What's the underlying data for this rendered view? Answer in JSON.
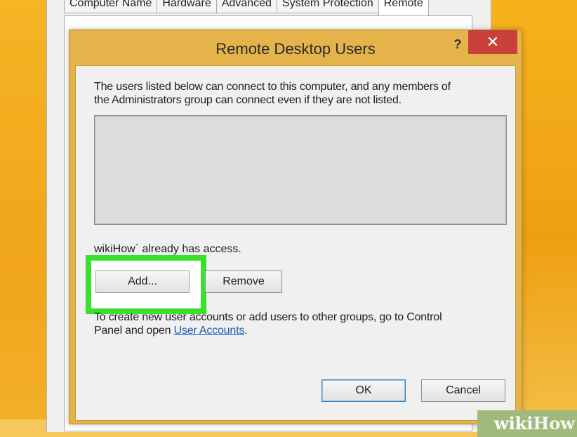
{
  "outer_window": {
    "tabs": [
      {
        "label": "Computer Name"
      },
      {
        "label": "Hardware"
      },
      {
        "label": "Advanced"
      },
      {
        "label": "System Protection"
      },
      {
        "label": "Remote"
      }
    ]
  },
  "dialog": {
    "title": "Remote Desktop Users",
    "help_label": "?",
    "close_label": "✕",
    "description_line1": "The users listed below can connect to this computer, and any members of",
    "description_line2": "the Administrators group can connect even if they are not listed.",
    "users": [],
    "access_text": "wikiHow` already has access.",
    "add_label": "Add...",
    "remove_label": "Remove",
    "info_line1": "To create new user accounts or add users to other groups, go to Control",
    "info_line2_prefix": "Panel and open ",
    "info_link": "User Accounts",
    "info_suffix": ".",
    "ok_label": "OK",
    "cancel_label": "Cancel"
  },
  "watermark": {
    "part1": "wiki",
    "part2": "How"
  },
  "colors": {
    "highlight": "#38e12c",
    "dialog_frame": "#e4b44b",
    "close_button": "#c7403a",
    "background": "#f2a417"
  }
}
